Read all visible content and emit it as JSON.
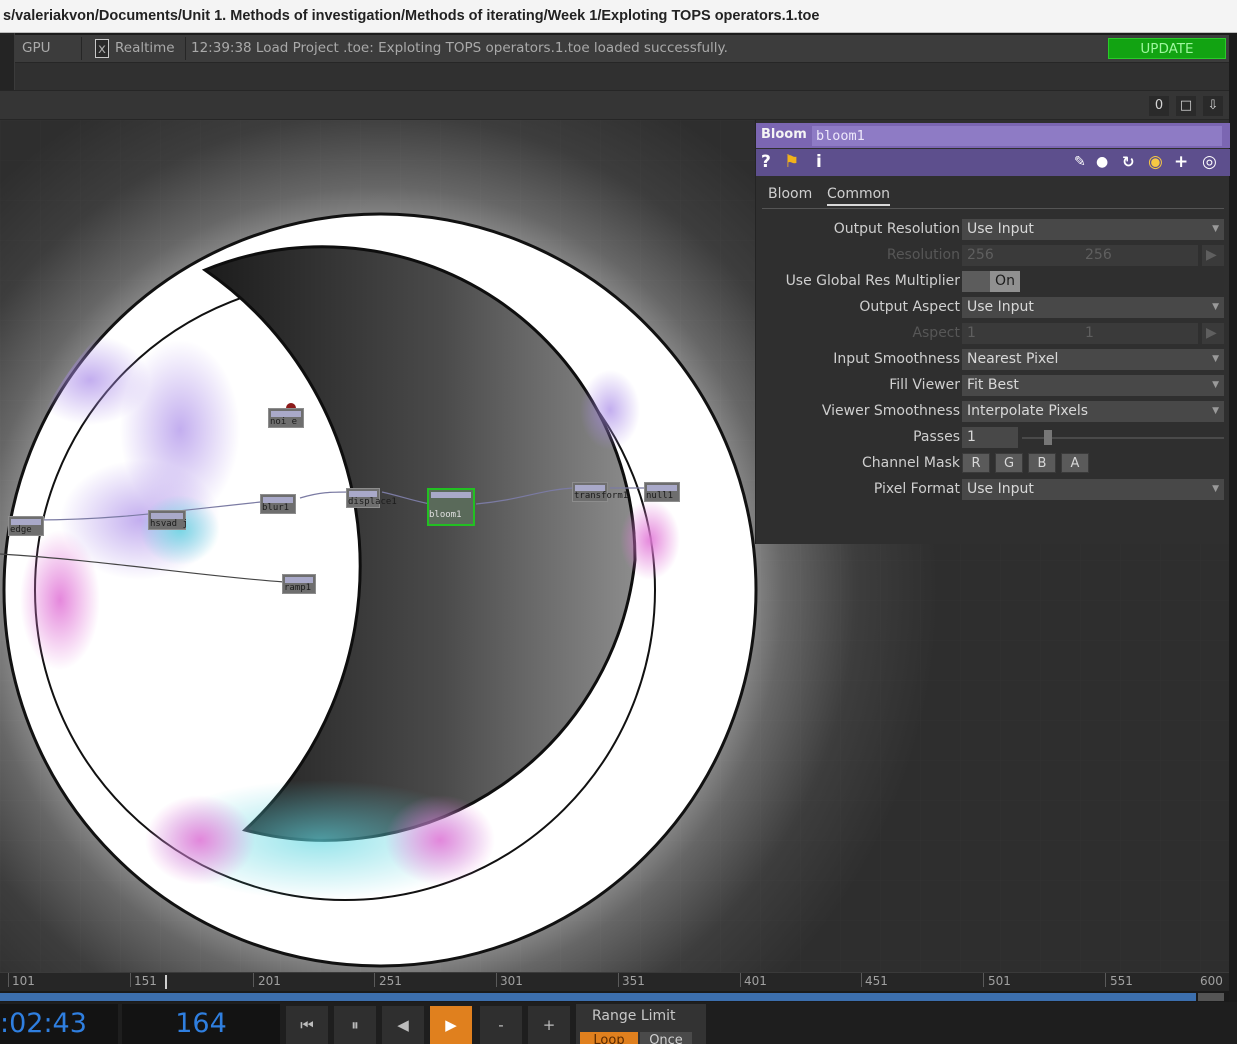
{
  "title_bar": {
    "path": "s/valeriakvon/Documents/Unit 1. Methods of investigation/Methods of iterating/Week 1/Exploting TOPS operators.1.toe"
  },
  "status_bar": {
    "gpu_label": "GPU",
    "realtime_check": "x",
    "realtime_label": "Realtime",
    "message": "12:39:38 Load Project .toe: Exploting TOPS operators.1.toe loaded successfully.",
    "update_label": "UPDATE"
  },
  "toolbar": {
    "counter": "0",
    "window_icon": "maximize-icon",
    "pin_icon": "pin-icon"
  },
  "network": {
    "nodes": [
      {
        "id": "noise",
        "label": "noi e"
      },
      {
        "id": "edge",
        "label": "edge"
      },
      {
        "id": "hsvadjust",
        "label": "hsvad j"
      },
      {
        "id": "blur",
        "label": "blur1"
      },
      {
        "id": "displace",
        "label": "displace1"
      },
      {
        "id": "bloom",
        "label": "bloom1"
      },
      {
        "id": "transform",
        "label": "transform1"
      },
      {
        "id": "null",
        "label": "null1"
      },
      {
        "id": "ramp",
        "label": "ramp1"
      }
    ]
  },
  "panel": {
    "op_type": "Bloom",
    "op_name": "bloom1",
    "icons": [
      "help-icon",
      "operator-info-icon",
      "info-icon",
      "edit-icon",
      "comment-icon",
      "refresh-icon",
      "python-icon",
      "add-icon",
      "target-icon"
    ],
    "tabs": [
      "Bloom",
      "Common"
    ],
    "active_tab": "Common",
    "params": {
      "output_resolution": {
        "label": "Output Resolution",
        "value": "Use Input"
      },
      "resolution": {
        "label": "Resolution",
        "w": "256",
        "h": "256"
      },
      "global_res": {
        "label": "Use Global Res Multiplier",
        "value": "On"
      },
      "output_aspect": {
        "label": "Output Aspect",
        "value": "Use Input"
      },
      "aspect": {
        "label": "Aspect",
        "x": "1",
        "y": "1"
      },
      "input_smoothness": {
        "label": "Input Smoothness",
        "value": "Nearest Pixel"
      },
      "fill_viewer": {
        "label": "Fill Viewer",
        "value": "Fit Best"
      },
      "viewer_smoothness": {
        "label": "Viewer Smoothness",
        "value": "Interpolate Pixels"
      },
      "passes": {
        "label": "Passes",
        "value": "1"
      },
      "channel_mask": {
        "label": "Channel Mask",
        "r": "R",
        "g": "G",
        "b": "B",
        "a": "A"
      },
      "pixel_format": {
        "label": "Pixel Format",
        "value": "Use Input"
      }
    }
  },
  "timeline": {
    "ticks": [
      "101",
      "151",
      "201",
      "251",
      "301",
      "351",
      "401",
      "451",
      "501",
      "551",
      "600"
    ],
    "current_frame": 164
  },
  "transport": {
    "timecode": ":02:43",
    "frame": "164",
    "buttons": {
      "rewind": "⏮",
      "pause": "⏸",
      "step_back": "◀",
      "play": "▶",
      "minus": "-",
      "plus": "+"
    },
    "range_limit_label": "Range Limit",
    "loop_label": "Loop",
    "once_label": "Once"
  }
}
